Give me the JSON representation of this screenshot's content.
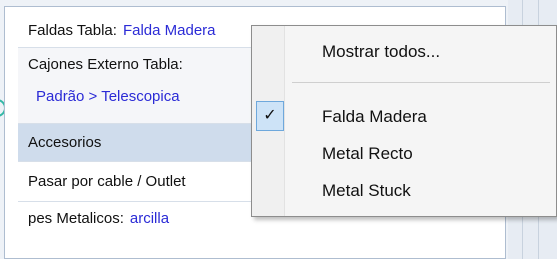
{
  "properties": {
    "rows": [
      {
        "label": "Faldas Tabla:",
        "value": "Falda Madera"
      },
      {
        "label": "Cajones Externo Tabla:",
        "value": "Padrão > Telescopica"
      },
      {
        "label": "Accesorios"
      },
      {
        "label": "Pasar por cable / Outlet"
      },
      {
        "label": "pes Metalicos:",
        "value": "arcilla"
      }
    ]
  },
  "context_menu": {
    "show_all": "Mostrar todos...",
    "items": [
      {
        "label": "Falda Madera",
        "checked": true,
        "check_glyph": "✓"
      },
      {
        "label": "Metal Recto",
        "checked": false
      },
      {
        "label": "Metal Stuck",
        "checked": false
      }
    ]
  },
  "colors": {
    "value_text": "#2b2bd6",
    "selected_row": "#cfdcec",
    "check_highlight": "#cde3f7"
  }
}
